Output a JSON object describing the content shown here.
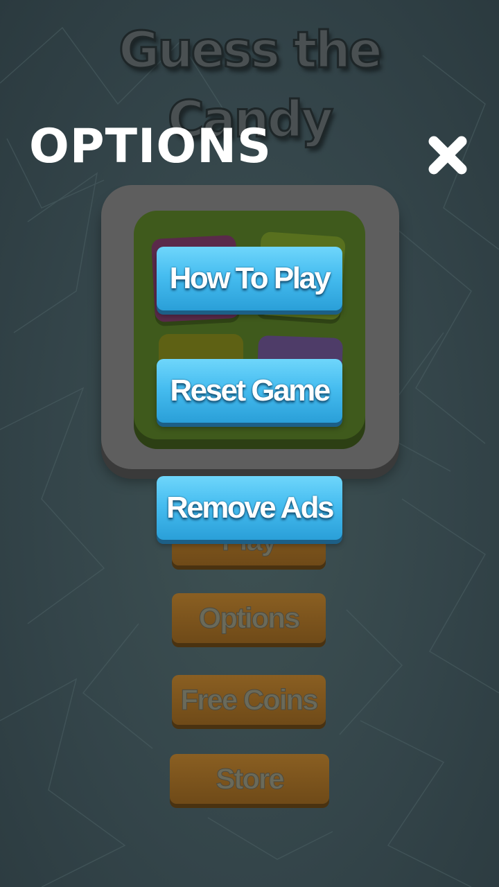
{
  "game": {
    "title_line1": "Guess the",
    "title_line2": "Candy",
    "menu": {
      "play_label": "Play",
      "options_label": "Options",
      "free_coins_label": "Free Coins",
      "store_label": "Store"
    }
  },
  "overlay": {
    "title": "OPTIONS",
    "close_icon": "close-icon",
    "buttons": {
      "how_to_play": "How To Play",
      "reset_game": "Reset Game",
      "remove_ads": "Remove Ads"
    }
  },
  "colors": {
    "background": "#34454a",
    "option_button": "#46bdf0",
    "menu_button": "#7a5420",
    "overlay_text": "#ffffff"
  }
}
